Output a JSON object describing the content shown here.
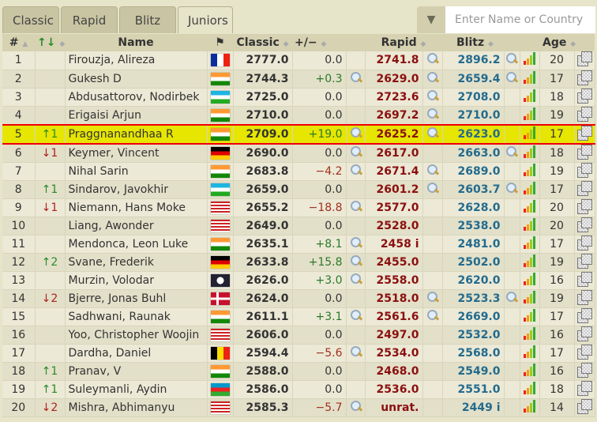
{
  "tabs": [
    "Classic",
    "Rapid",
    "Blitz",
    "Juniors"
  ],
  "active_tab": "Juniors",
  "search": {
    "placeholder": "Enter Name or Country"
  },
  "headers": {
    "rank": "#",
    "change": "↑↓",
    "name": "Name",
    "classic": "Classic",
    "diff": "+/−",
    "rapid": "Rapid",
    "blitz": "Blitz",
    "age": "Age"
  },
  "colors": {
    "highlight": "#e6e600",
    "highlight_border": "#e00000",
    "rapid": "#8b1010",
    "blitz": "#236b8e"
  },
  "highlighted_rank": "5",
  "rows": [
    {
      "rank": "1",
      "change": "",
      "name": "Firouzja, Alireza",
      "flag": "FRA",
      "classic": "2777.0",
      "diff": "0.0",
      "rapid": "2741.8",
      "blitz": "2896.2",
      "age": "20",
      "m": [
        0,
        1,
        1
      ]
    },
    {
      "rank": "2",
      "change": "",
      "name": "Gukesh D",
      "flag": "IND",
      "classic": "2744.3",
      "diff": "+0.3",
      "rapid": "2629.0",
      "blitz": "2659.4",
      "age": "17",
      "m": [
        1,
        1,
        1
      ]
    },
    {
      "rank": "3",
      "change": "",
      "name": "Abdusattorov, Nodirbek",
      "flag": "UZB",
      "classic": "2725.0",
      "diff": "0.0",
      "rapid": "2723.6",
      "blitz": "2708.0",
      "age": "18",
      "m": [
        0,
        1,
        0
      ]
    },
    {
      "rank": "4",
      "change": "",
      "name": "Erigaisi Arjun",
      "flag": "IND",
      "classic": "2710.0",
      "diff": "0.0",
      "rapid": "2697.2",
      "blitz": "2710.0",
      "age": "19",
      "m": [
        0,
        1,
        0
      ]
    },
    {
      "rank": "5",
      "change": "↑1",
      "name": "Praggnanandhaa R",
      "flag": "IND",
      "classic": "2709.0",
      "diff": "+19.0",
      "rapid": "2625.2",
      "blitz": "2623.0",
      "age": "17",
      "m": [
        1,
        1,
        0
      ]
    },
    {
      "rank": "6",
      "change": "↓1",
      "name": "Keymer, Vincent",
      "flag": "GER",
      "classic": "2690.0",
      "diff": "0.0",
      "rapid": "2617.0",
      "blitz": "2663.0",
      "age": "18",
      "m": [
        1,
        0,
        1
      ]
    },
    {
      "rank": "7",
      "change": "",
      "name": "Nihal Sarin",
      "flag": "IND",
      "classic": "2683.8",
      "diff": "−4.2",
      "rapid": "2671.4",
      "blitz": "2689.0",
      "age": "19",
      "m": [
        1,
        1,
        0
      ]
    },
    {
      "rank": "8",
      "change": "↑1",
      "name": "Sindarov, Javokhir",
      "flag": "UZB",
      "classic": "2659.0",
      "diff": "0.0",
      "rapid": "2601.2",
      "blitz": "2603.7",
      "age": "17",
      "m": [
        0,
        1,
        1
      ]
    },
    {
      "rank": "9",
      "change": "↓1",
      "name": "Niemann, Hans Moke",
      "flag": "USA",
      "classic": "2655.2",
      "diff": "−18.8",
      "rapid": "2577.0",
      "blitz": "2628.0",
      "age": "20",
      "m": [
        1,
        0,
        0
      ]
    },
    {
      "rank": "10",
      "change": "",
      "name": "Liang, Awonder",
      "flag": "USA",
      "classic": "2649.0",
      "diff": "0.0",
      "rapid": "2528.0",
      "blitz": "2538.0",
      "age": "20",
      "m": [
        0,
        0,
        0
      ]
    },
    {
      "rank": "11",
      "change": "",
      "name": "Mendonca, Leon Luke",
      "flag": "IND",
      "classic": "2635.1",
      "diff": "+8.1",
      "rapid": "2458 i",
      "blitz": "2481.0",
      "age": "17",
      "m": [
        1,
        0,
        0
      ]
    },
    {
      "rank": "12",
      "change": "↑2",
      "name": "Svane, Frederik",
      "flag": "GER",
      "classic": "2633.8",
      "diff": "+15.8",
      "rapid": "2455.0",
      "blitz": "2502.0",
      "age": "19",
      "m": [
        1,
        0,
        0
      ]
    },
    {
      "rank": "13",
      "change": "",
      "name": "Murzin, Volodar",
      "flag": "FIDE",
      "classic": "2626.0",
      "diff": "+3.0",
      "rapid": "2558.0",
      "blitz": "2620.0",
      "age": "16",
      "m": [
        1,
        0,
        0
      ]
    },
    {
      "rank": "14",
      "change": "↓2",
      "name": "Bjerre, Jonas Buhl",
      "flag": "DEN",
      "classic": "2624.0",
      "diff": "0.0",
      "rapid": "2518.0",
      "blitz": "2523.3",
      "age": "19",
      "m": [
        0,
        1,
        1
      ]
    },
    {
      "rank": "15",
      "change": "",
      "name": "Sadhwani, Raunak",
      "flag": "IND",
      "classic": "2611.1",
      "diff": "+3.1",
      "rapid": "2561.6",
      "blitz": "2669.0",
      "age": "17",
      "m": [
        1,
        1,
        0
      ]
    },
    {
      "rank": "16",
      "change": "",
      "name": "Yoo, Christopher Woojin",
      "flag": "USA",
      "classic": "2606.0",
      "diff": "0.0",
      "rapid": "2497.0",
      "blitz": "2532.0",
      "age": "16",
      "m": [
        0,
        0,
        0
      ]
    },
    {
      "rank": "17",
      "change": "",
      "name": "Dardha, Daniel",
      "flag": "BEL",
      "classic": "2594.4",
      "diff": "−5.6",
      "rapid": "2534.0",
      "blitz": "2568.0",
      "age": "17",
      "m": [
        1,
        0,
        0
      ]
    },
    {
      "rank": "18",
      "change": "↑1",
      "name": "Pranav, V",
      "flag": "IND",
      "classic": "2588.0",
      "diff": "0.0",
      "rapid": "2468.0",
      "blitz": "2549.0",
      "age": "16",
      "m": [
        0,
        0,
        0
      ]
    },
    {
      "rank": "19",
      "change": "↑1",
      "name": "Suleymanli, Aydin",
      "flag": "AZE",
      "classic": "2586.0",
      "diff": "0.0",
      "rapid": "2536.0",
      "blitz": "2551.0",
      "age": "18",
      "m": [
        0,
        0,
        0
      ]
    },
    {
      "rank": "20",
      "change": "↓2",
      "name": "Mishra, Abhimanyu",
      "flag": "USA",
      "classic": "2585.3",
      "diff": "−5.7",
      "rapid": "unrat.",
      "blitz": "2449 i",
      "age": "14",
      "m": [
        1,
        0,
        0
      ]
    }
  ]
}
